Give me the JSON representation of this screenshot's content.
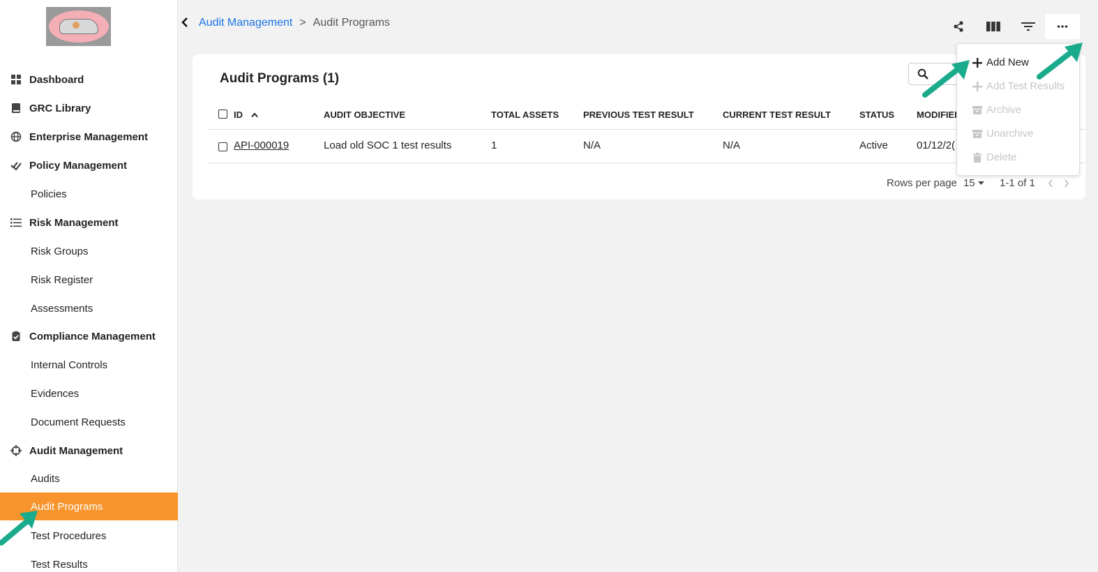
{
  "sidebar": {
    "items": [
      {
        "label": "Dashboard",
        "icon": "grid-icon",
        "type": "section"
      },
      {
        "label": "GRC Library",
        "icon": "book-icon",
        "type": "section"
      },
      {
        "label": "Enterprise Management",
        "icon": "globe-icon",
        "type": "section"
      },
      {
        "label": "Policy Management",
        "icon": "check-double-icon",
        "type": "section"
      },
      {
        "label": "Policies",
        "type": "sub"
      },
      {
        "label": "Risk Management",
        "icon": "list-icon",
        "type": "section"
      },
      {
        "label": "Risk Groups",
        "type": "sub"
      },
      {
        "label": "Risk Register",
        "type": "sub"
      },
      {
        "label": "Assessments",
        "type": "sub"
      },
      {
        "label": "Compliance Management",
        "icon": "clipboard-check-icon",
        "type": "section"
      },
      {
        "label": "Internal Controls",
        "type": "sub"
      },
      {
        "label": "Evidences",
        "type": "sub"
      },
      {
        "label": "Document Requests",
        "type": "sub"
      },
      {
        "label": "Audit Management",
        "icon": "crosshair-icon",
        "type": "section"
      },
      {
        "label": "Audits",
        "type": "sub"
      },
      {
        "label": "Audit Programs",
        "type": "sub",
        "active": true
      },
      {
        "label": "Test Procedures",
        "type": "sub"
      },
      {
        "label": "Test Results",
        "type": "sub"
      }
    ],
    "active_color": "#f7942c"
  },
  "breadcrumb": {
    "parent": "Audit Management",
    "separator": ">",
    "current": "Audit Programs"
  },
  "toolbar": {
    "icons": [
      "share-icon",
      "columns-icon",
      "filter-icon",
      "more-icon"
    ]
  },
  "table": {
    "title": "Audit Programs (1)",
    "columns": [
      "ID",
      "AUDIT OBJECTIVE",
      "TOTAL ASSETS",
      "PREVIOUS TEST RESULT",
      "CURRENT TEST RESULT",
      "STATUS",
      "MODIFIEI"
    ],
    "rows": [
      {
        "id": "API-000019",
        "objective": "Load old SOC 1 test results",
        "total_assets": "1",
        "previous": "N/A",
        "current": "N/A",
        "status": "Active",
        "modified": "01/12/2("
      }
    ],
    "rows_per_page_label": "Rows per page",
    "rows_per_page": "15",
    "range": "1-1 of 1"
  },
  "menu": {
    "items": [
      {
        "label": "Add New",
        "icon": "plus-icon",
        "enabled": true
      },
      {
        "label": "Add Test Results",
        "icon": "plus-icon",
        "enabled": false
      },
      {
        "label": "Archive",
        "icon": "archive-icon",
        "enabled": false
      },
      {
        "label": "Unarchive",
        "icon": "archive-icon",
        "enabled": false
      },
      {
        "label": "Delete",
        "icon": "trash-icon",
        "enabled": false
      }
    ]
  },
  "colors": {
    "link": "#1a73e8",
    "arrow": "#1aab8c"
  }
}
